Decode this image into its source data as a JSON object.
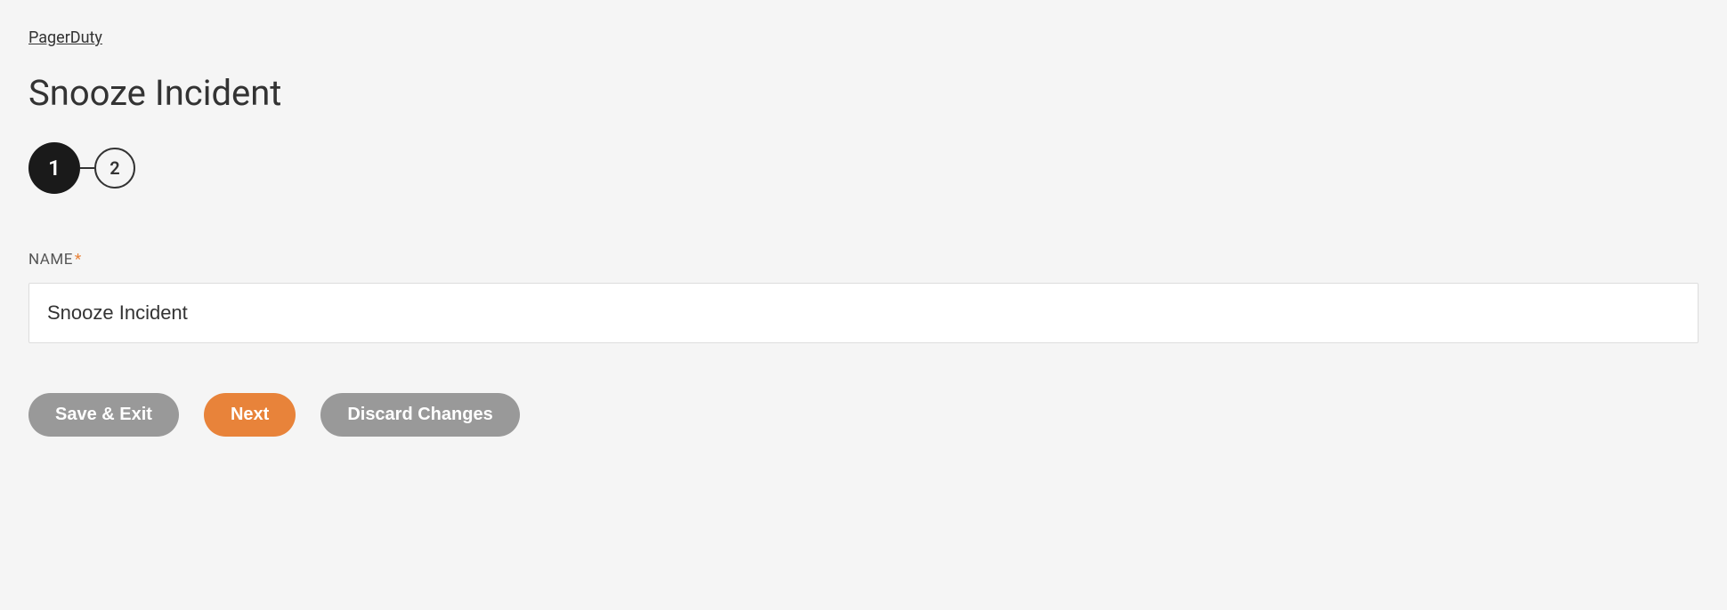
{
  "breadcrumb": {
    "label": "PagerDuty"
  },
  "page": {
    "title": "Snooze Incident"
  },
  "stepper": {
    "steps": [
      {
        "number": "1",
        "active": true
      },
      {
        "number": "2",
        "active": false
      }
    ]
  },
  "form": {
    "name": {
      "label": "NAME",
      "required_mark": "*",
      "value": "Snooze Incident"
    }
  },
  "buttons": {
    "save_exit": "Save & Exit",
    "next": "Next",
    "discard": "Discard Changes"
  }
}
